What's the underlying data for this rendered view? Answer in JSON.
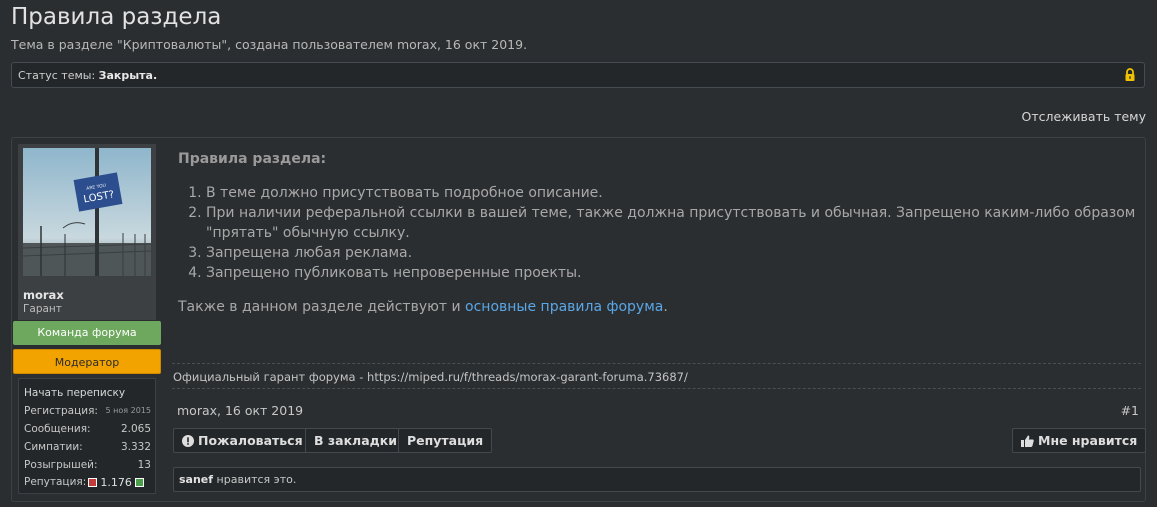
{
  "thread": {
    "title": "Правила раздела",
    "subtitle": "Тема в разделе \"Криптовалюты\", создана пользователем morax, 16 окт 2019.",
    "status_label": "Статус темы:",
    "status_value": "Закрыта.",
    "watch_label": "Отслеживать тему"
  },
  "user": {
    "name": "morax",
    "title": "Гарант",
    "avatar_text_top": "ARE YOU",
    "avatar_text_main": "LOST?",
    "badge_team": "Команда форума",
    "badge_mod": "Модератор",
    "start_conversation": "Начать переписку",
    "stats": [
      {
        "key": "Регистрация:",
        "value": "5 ноя 2015"
      },
      {
        "key": "Сообщения:",
        "value": "2.065"
      },
      {
        "key": "Симпатии:",
        "value": "3.332"
      },
      {
        "key": "Розыгрышей:",
        "value": "13"
      }
    ],
    "reputation_label": "Репутация:",
    "reputation_value": "1.176"
  },
  "post": {
    "heading": "Правила раздела:",
    "rules": [
      "В теме должно присутствовать подробное описание.",
      "При наличии реферальной ссылки в вашей теме, также должна присутствовать и обычная. Запрещено каким-либо образом \"прятать\" обычную ссылку.",
      "Запрещена любая реклама.",
      "Запрещено публиковать непроверенные проекты."
    ],
    "also_prefix": "Также в данном разделе действуют и ",
    "also_link": "основные правила форума",
    "also_suffix": ".",
    "signature": "Официальный гарант форума - https://miped.ru/f/threads/morax-garant-foruma.73687/",
    "author_date": "morax, 16 окт 2019",
    "post_number": "#1",
    "buttons": {
      "report": "Пожаловаться",
      "bookmark": "В закладки",
      "reputation": "Репутация",
      "like": "Мне нравится"
    },
    "likes_user": "sanef",
    "likes_suffix": " нравится это."
  },
  "colors": {
    "accent_link": "#5aa6e6",
    "badge_team": "#6ea85f",
    "badge_mod": "#f3a300",
    "lock": "#f2c200"
  }
}
